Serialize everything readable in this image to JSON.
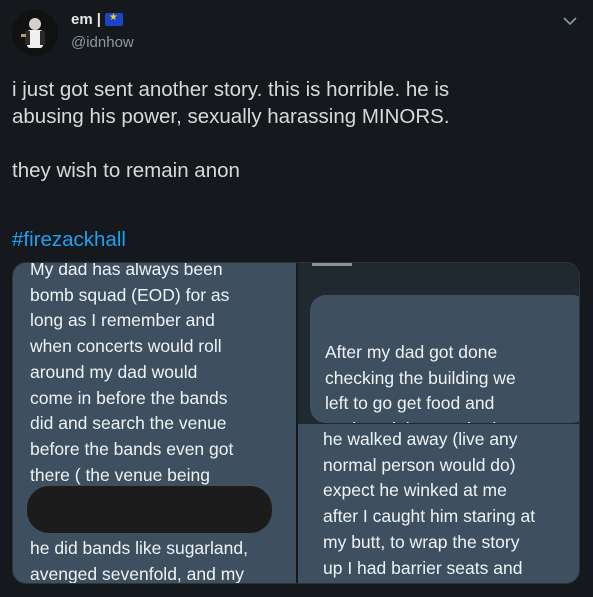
{
  "user": {
    "display_name": "em",
    "separator": "|",
    "handle": "@idnhow"
  },
  "tweet": {
    "text": "i just got sent another story. this is horrible. he is\nabusing his power, sexually harassing MINORS.\n\nthey wish to remain anon",
    "hashtag": "#firezackhall"
  },
  "media": {
    "left_story": "My dad has always been\nbomb squad (EOD) for as\nlong as I remember and\nwhen concerts would roll\naround my dad would\ncome in before the bands\ndid and search the venue\nbefore the bands even got\nthere ( the venue being",
    "left_story_bottom": "he did bands like sugarland,\navenged sevenfold, and my",
    "right_story_top": "After my dad got done\nchecking the building we\nleft to go get food and\nsuch and then we had to\ncome back when we did I",
    "right_story_bottom": "he walked away (live any\nnormal person would do)\nexpect he winked at me\nafter I caught him staring at\nmy butt, to wrap the story\nup I had barrier seats and"
  },
  "colors": {
    "background": "#15181c",
    "hashtag": "#1da1f2",
    "panel": "#3e5060"
  },
  "icons": [
    "chevron-down-icon",
    "eu-flag-icon"
  ]
}
